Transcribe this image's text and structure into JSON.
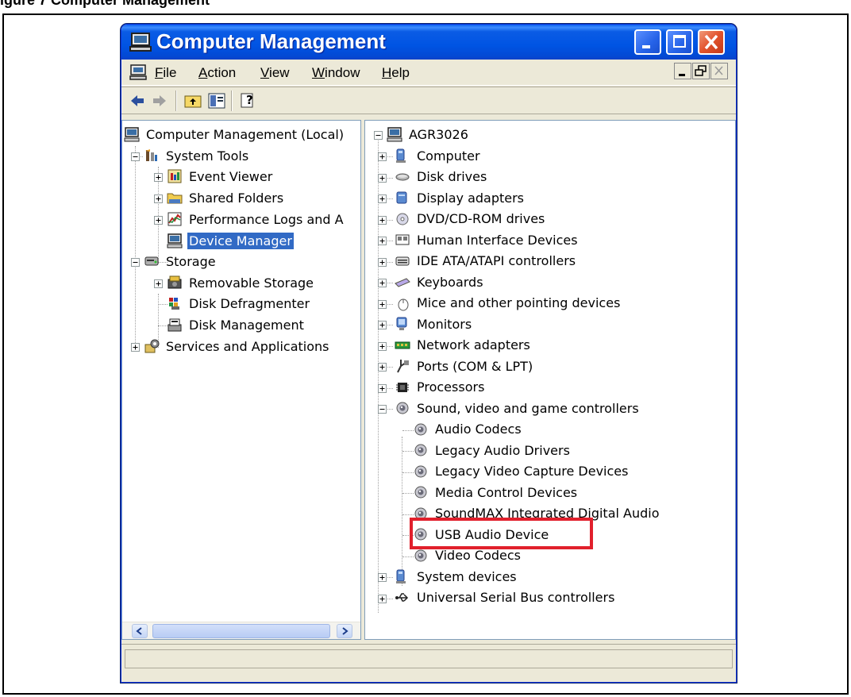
{
  "figure": {
    "caption": "igure 7 Computer Management"
  },
  "window": {
    "title": "Computer Management"
  },
  "menu": {
    "items": [
      {
        "label_ul": "F",
        "label_rest": "ile"
      },
      {
        "label_ul": "A",
        "label_rest": "ction"
      },
      {
        "label_ul": "V",
        "label_rest": "iew"
      },
      {
        "label_ul": "W",
        "label_rest": "indow"
      },
      {
        "label_ul": "H",
        "label_rest": "elp"
      }
    ]
  },
  "toolbar": {
    "icons": [
      "back-arrow-icon",
      "forward-arrow-icon",
      "up-folder-icon",
      "show-hide-tree-icon",
      "help-icon"
    ]
  },
  "left_tree": {
    "items": [
      {
        "label": "Computer Management (Local)",
        "icon": "computer-management-icon"
      },
      {
        "label": "System Tools",
        "icon": "system-tools-icon"
      },
      {
        "label": "Event Viewer",
        "icon": "event-viewer-icon"
      },
      {
        "label": "Shared Folders",
        "icon": "shared-folders-icon"
      },
      {
        "label": "Performance Logs and A",
        "icon": "performance-logs-icon"
      },
      {
        "label": "Device Manager",
        "icon": "device-manager-icon"
      },
      {
        "label": "Storage",
        "icon": "storage-icon"
      },
      {
        "label": "Removable Storage",
        "icon": "removable-storage-icon"
      },
      {
        "label": "Disk Defragmenter",
        "icon": "disk-defragmenter-icon"
      },
      {
        "label": "Disk Management",
        "icon": "disk-management-icon"
      },
      {
        "label": "Services and Applications",
        "icon": "services-applications-icon"
      }
    ]
  },
  "right_tree": {
    "root": "AGR3026",
    "items": [
      {
        "label": "Computer",
        "icon": "computer-icon"
      },
      {
        "label": "Disk drives",
        "icon": "disk-drive-icon"
      },
      {
        "label": "Display adapters",
        "icon": "display-adapter-icon"
      },
      {
        "label": "DVD/CD-ROM drives",
        "icon": "dvd-drive-icon"
      },
      {
        "label": "Human Interface Devices",
        "icon": "hid-icon"
      },
      {
        "label": "IDE ATA/ATAPI controllers",
        "icon": "ide-controller-icon"
      },
      {
        "label": "Keyboards",
        "icon": "keyboard-icon"
      },
      {
        "label": "Mice and other pointing devices",
        "icon": "mouse-icon"
      },
      {
        "label": "Monitors",
        "icon": "monitor-icon"
      },
      {
        "label": "Network adapters",
        "icon": "network-adapter-icon"
      },
      {
        "label": "Ports (COM & LPT)",
        "icon": "port-icon"
      },
      {
        "label": "Processors",
        "icon": "processor-icon"
      },
      {
        "label": "Sound, video and game controllers",
        "icon": "sound-icon"
      },
      {
        "label": "Audio Codecs",
        "icon": "sound-icon"
      },
      {
        "label": "Legacy Audio Drivers",
        "icon": "sound-icon"
      },
      {
        "label": "Legacy Video Capture Devices",
        "icon": "sound-icon"
      },
      {
        "label": "Media Control Devices",
        "icon": "sound-icon"
      },
      {
        "label": "SoundMAX Integrated Digital Audio",
        "icon": "sound-icon"
      },
      {
        "label": "USB Audio Device",
        "icon": "sound-icon"
      },
      {
        "label": "Video Codecs",
        "icon": "sound-icon"
      },
      {
        "label": "System devices",
        "icon": "system-devices-icon"
      },
      {
        "label": "Universal Serial Bus controllers",
        "icon": "usb-icon"
      }
    ]
  },
  "colors": {
    "highlight": "#E1202C",
    "selection": "#316AC5",
    "titlebar": "#0054E3"
  }
}
